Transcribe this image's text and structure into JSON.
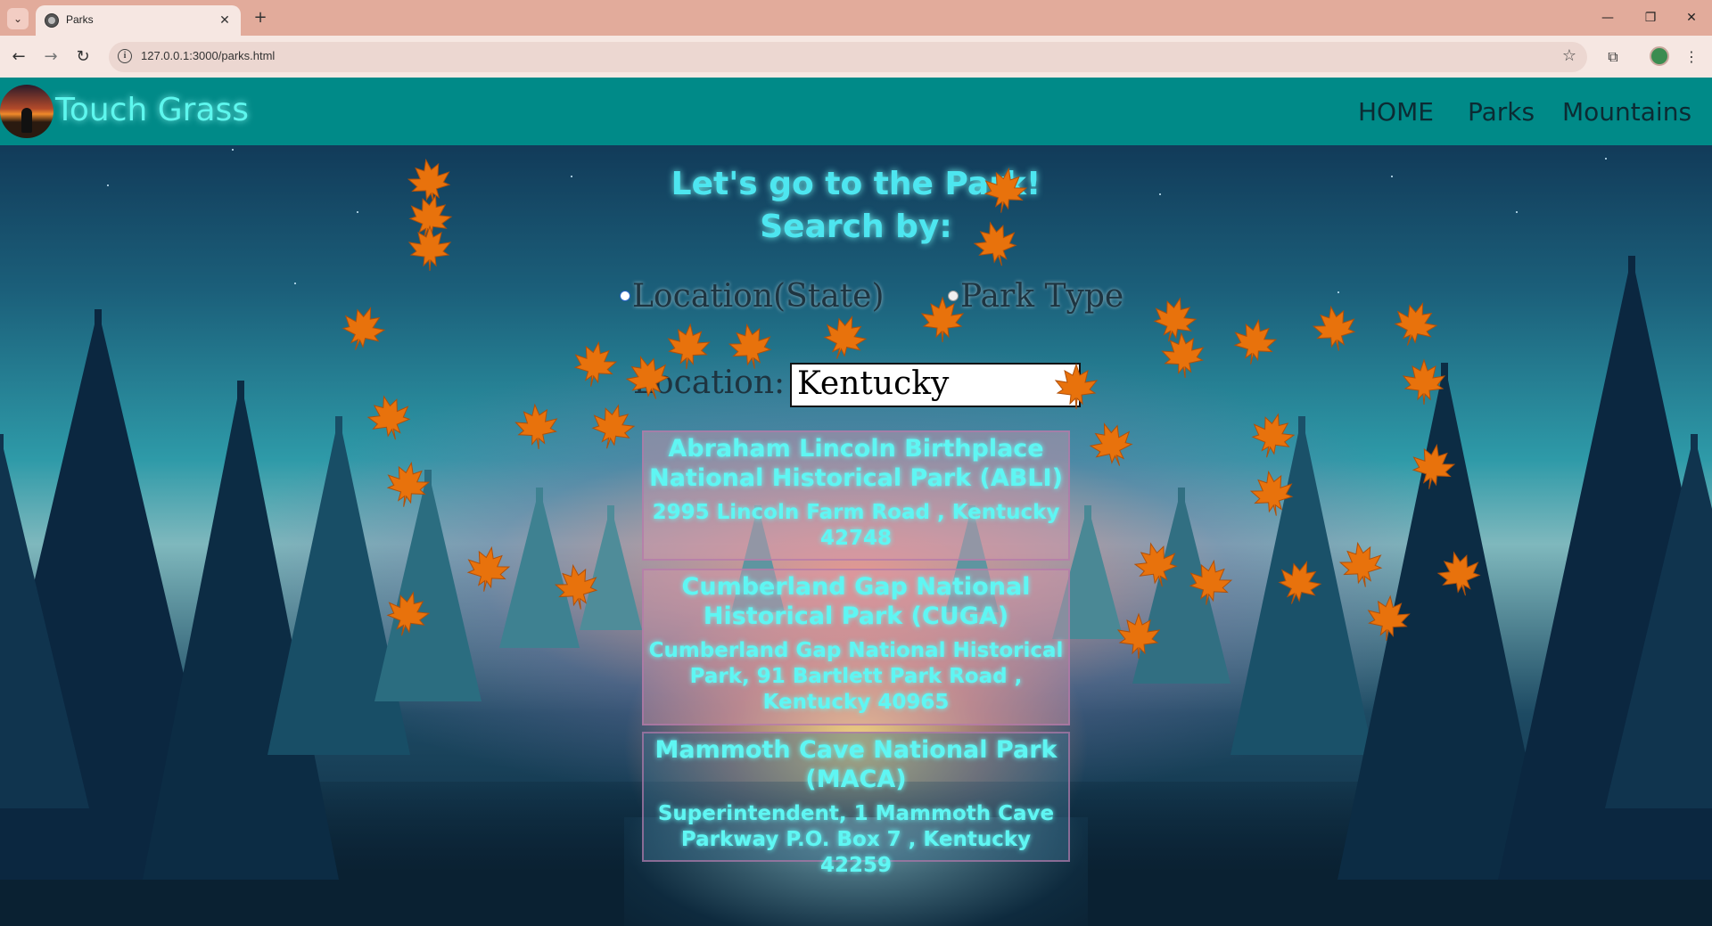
{
  "browser": {
    "tab_title": "Parks",
    "url": "127.0.0.1:3000/parks.html"
  },
  "site": {
    "brand": "Touch Grass",
    "nav": [
      "HOME",
      "Parks",
      "Mountains"
    ]
  },
  "main": {
    "title_line1": "Let's go to the Park!",
    "title_line2": "Search by:",
    "search_options": [
      "Location(State)",
      "Park Type"
    ],
    "location_label": "Location:",
    "location_value": "Kentucky"
  },
  "parks": [
    {
      "name": "Abraham Lincoln Birthplace National Historical Park (ABLI)",
      "address": "2995 Lincoln Farm Road , Kentucky 42748"
    },
    {
      "name": "Cumberland Gap National Historical Park (CUGA)",
      "address": "Cumberland Gap National Historical Park, 91 Bartlett Park Road , Kentucky 40965"
    },
    {
      "name": "Mammoth Cave National Park (MACA)",
      "address": "Superintendent, 1 Mammoth Cave Parkway P.O. Box 7 , Kentucky 42259"
    }
  ],
  "colors": {
    "header_bg": "#008a88",
    "brand_text": "#5df7ee",
    "title_text": "#4de6f0",
    "leaf": "#e8720c",
    "tabstrip": "#e2ab9b"
  },
  "icons": {
    "tab_list": "chevron-down-icon",
    "favicon": "globe-icon",
    "back": "back-arrow-icon",
    "forward": "forward-arrow-icon",
    "reload": "reload-icon",
    "site_info": "info-icon",
    "bookmark": "star-icon",
    "extensions": "puzzle-icon",
    "menu": "kebab-menu-icon"
  }
}
